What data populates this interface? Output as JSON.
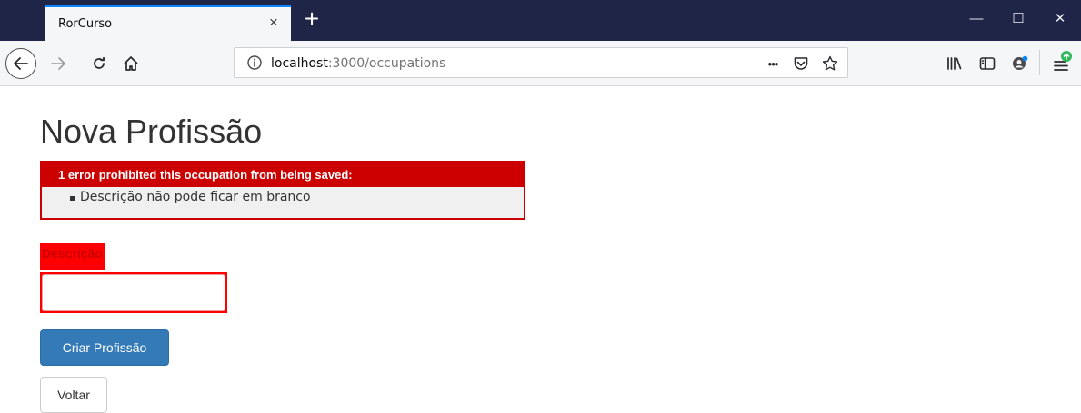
{
  "browser": {
    "tab_title": "RorCurso",
    "tab_close": "×",
    "new_tab": "+",
    "url_host": "localhost",
    "url_path": ":3000/occupations",
    "page_actions_ellipsis": "•••",
    "window_controls": {
      "minimize": "—",
      "maximize": "☐",
      "close": "✕"
    }
  },
  "icons": {
    "back": "back-arrow-icon",
    "forward": "forward-arrow-icon",
    "reload": "reload-icon",
    "home": "home-icon",
    "info": "info-icon",
    "pocket": "pocket-icon",
    "bookmark": "star-icon",
    "library": "library-icon",
    "sidebar": "sidebar-icon",
    "account": "account-icon",
    "menu": "hamburger-menu-icon"
  },
  "page": {
    "title": "Nova Profissão",
    "error_header": "1 error prohibited this occupation from being saved:",
    "errors": [
      "Descrição não pode ficar em branco"
    ],
    "field_label": "Descrição",
    "field_value": "",
    "submit_label": "Criar Profissão",
    "back_label": "Voltar"
  },
  "colors": {
    "tabstrip": "#1f2547",
    "error_red": "#cc0000",
    "field_error_bg": "#ff0000",
    "primary": "#337ab7"
  }
}
